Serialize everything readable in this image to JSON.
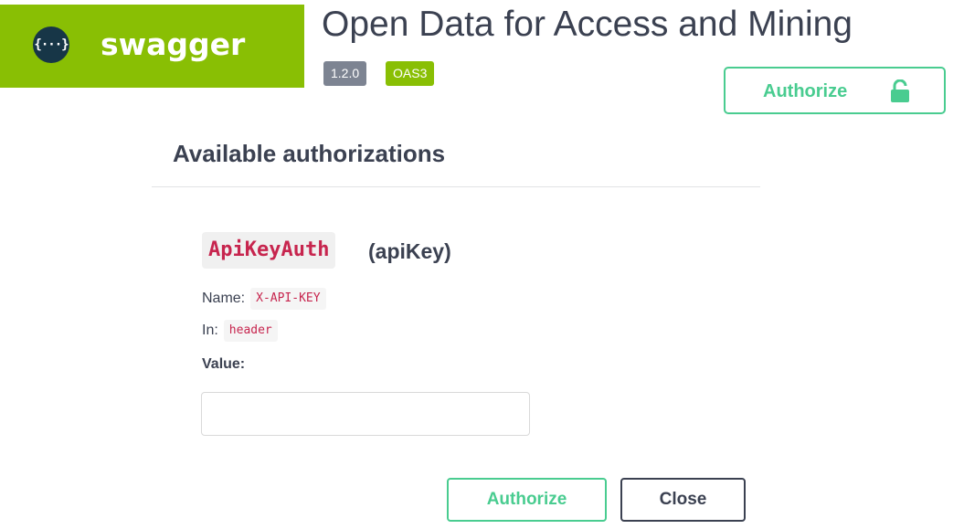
{
  "header": {
    "logo_text": "swagger",
    "logo_mark_glyph": "{···}",
    "title": "Open Data for Access and Mining",
    "version_badge": "1.2.0",
    "oas_badge": "OAS3",
    "authorize_label": "Authorize",
    "lock_icon": "unlocked-padlock-icon"
  },
  "modal": {
    "title": "Available authorizations",
    "scheme": {
      "name": "ApiKeyAuth",
      "type": "(apiKey)",
      "name_label": "Name:",
      "name_value": "X-API-KEY",
      "in_label": "In:",
      "in_value": "header",
      "value_label": "Value:",
      "value_input": ""
    },
    "buttons": {
      "authorize": "Authorize",
      "close": "Close"
    }
  },
  "colors": {
    "brand_green": "#89bf04",
    "authorize_green": "#49cc90",
    "text_dark": "#3b4151",
    "version_gray": "#7d8492",
    "code_red": "#c7254e"
  }
}
